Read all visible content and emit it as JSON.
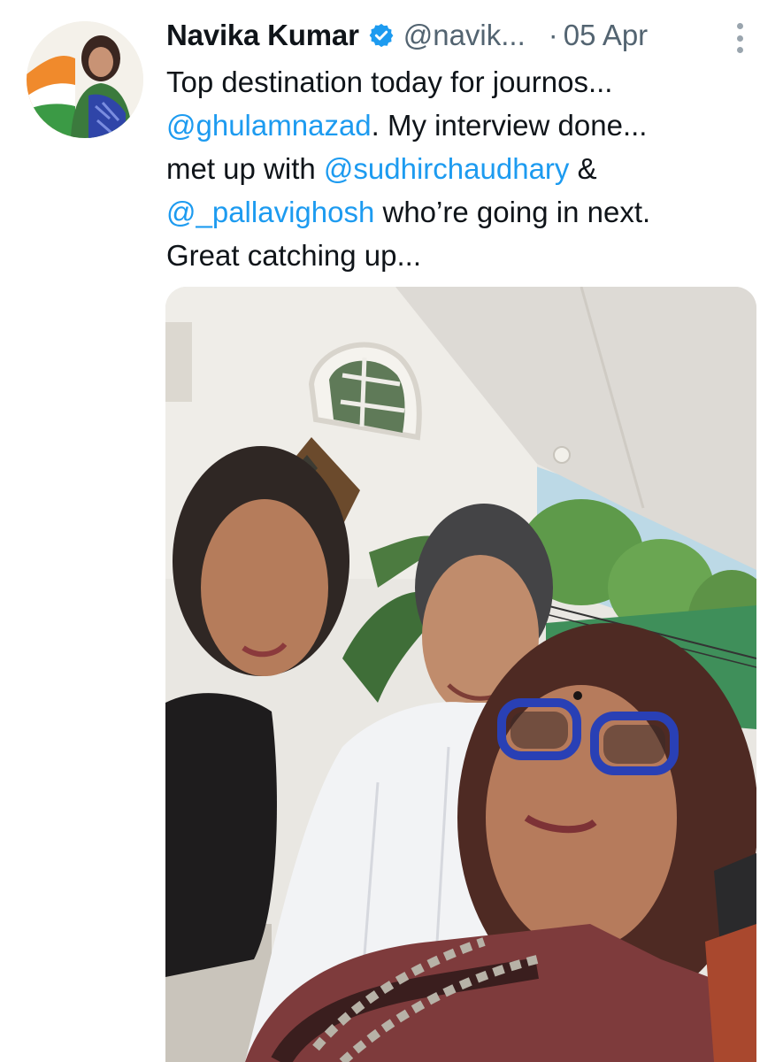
{
  "tweet": {
    "author": {
      "name": "Navika Kumar",
      "handle": "@navik...",
      "verified": true,
      "avatar_icon": "profile-photo"
    },
    "separator": "·",
    "date": "05 Apr",
    "text_lines": [
      [
        {
          "t": "Top destination today for journos..."
        }
      ],
      [
        {
          "t": "@ghulamnazad",
          "mention": true
        },
        {
          "t": ". My interview done..."
        }
      ],
      [
        {
          "t": "met up with "
        },
        {
          "t": "@sudhirchaudhary",
          "mention": true
        },
        {
          "t": " &"
        }
      ],
      [
        {
          "t": "@_pallavighosh",
          "mention": true
        },
        {
          "t": " who’re going in next."
        }
      ],
      [
        {
          "t": "Great catching up..."
        }
      ]
    ],
    "media": {
      "type": "photo"
    },
    "more_icon": "more-vertical-icon"
  },
  "colors": {
    "mention": "#1d9bf0",
    "text": "#0f1419",
    "secondary": "#536471",
    "verified_badge": "#1d9bf0"
  }
}
